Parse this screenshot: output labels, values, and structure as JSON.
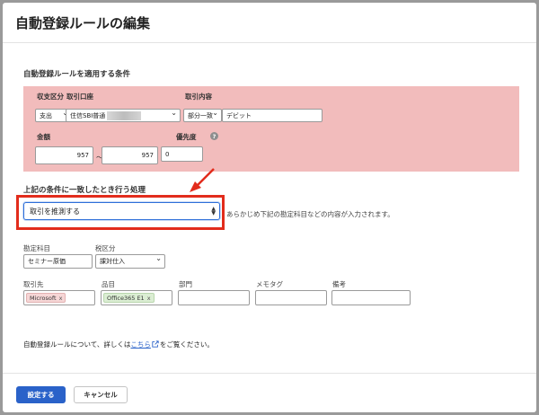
{
  "dialog": {
    "title": "自動登録ルールの編集"
  },
  "conditions": {
    "heading": "自動登録ルールを適用する条件",
    "income_type": {
      "label": "収支区分",
      "value": "支出"
    },
    "account": {
      "label": "取引口座",
      "value": "住信SBI普通"
    },
    "transaction_content": {
      "label": "取引内容",
      "match_value": "部分一致",
      "text": "デビット"
    },
    "amount": {
      "label": "金額",
      "min": "957",
      "separator": "～",
      "max": "957"
    },
    "priority": {
      "label": "優先度",
      "value": "0"
    }
  },
  "action": {
    "heading": "上記の条件に一致したとき行う処理",
    "select_value": "取引を推測する",
    "description": "あらかじめ下記の勘定科目などの内容が入力されます。"
  },
  "details": {
    "account_item": {
      "label": "勘定科目",
      "value": "セミナー原価"
    },
    "tax": {
      "label": "税区分",
      "value": "課対仕入"
    },
    "partner": {
      "label": "取引先",
      "tag": "Microsoft",
      "tag_close": "x"
    },
    "item": {
      "label": "品目",
      "tag": "Office365 E1",
      "tag_close": "x"
    },
    "department": {
      "label": "部門",
      "value": ""
    },
    "memo_tag": {
      "label": "メモタグ",
      "value": ""
    },
    "remarks": {
      "label": "備考",
      "value": ""
    }
  },
  "info": {
    "before": "自動登録ルールについて、詳しくは",
    "link": "こちら",
    "after": "をご覧ください。"
  },
  "footer": {
    "submit_label": "設定する",
    "cancel_label": "キャンセル"
  },
  "colors": {
    "highlight_red": "#e22c1c",
    "conditions_bg": "#f2bcbc",
    "primary": "#2a62c9"
  }
}
